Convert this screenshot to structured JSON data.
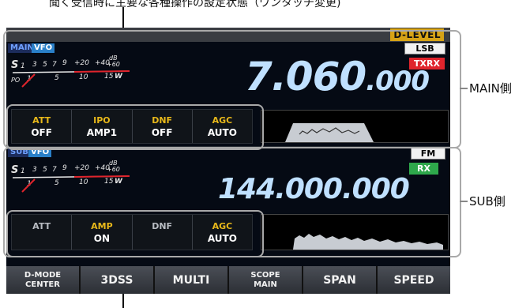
{
  "annotations": {
    "top_caption": "聞く受信時に主要な各種操作の設定状態（ワンタッチ変更)",
    "main_side": "MAIN側",
    "sub_side": "SUB側"
  },
  "header": {
    "dlevel": "D-LEVEL"
  },
  "main": {
    "badge_main": "MAIN",
    "badge_vfo": "VFO",
    "mode": "LSB",
    "txrx": "TXRX",
    "frequency": "7.060",
    "frequency_decimals": ".000",
    "functions": [
      {
        "name": "ATT",
        "value": "OFF",
        "name_color": "yellow"
      },
      {
        "name": "IPO",
        "value": "AMP1",
        "name_color": "yellow"
      },
      {
        "name": "DNF",
        "value": "OFF",
        "name_color": "yellow"
      },
      {
        "name": "AGC",
        "value": "AUTO",
        "name_color": "yellow"
      }
    ]
  },
  "sub": {
    "badge_sub": "SUB",
    "badge_vfo": "VFO",
    "mode": "FM",
    "rx": "RX",
    "frequency": "144.000.000",
    "functions": [
      {
        "name": "ATT",
        "value": "",
        "name_color": "gray"
      },
      {
        "name": "AMP",
        "value": "ON",
        "name_color": "yellow"
      },
      {
        "name": "DNF",
        "value": "",
        "name_color": "gray"
      },
      {
        "name": "AGC",
        "value": "AUTO",
        "name_color": "yellow"
      }
    ]
  },
  "meter": {
    "s_label": "S",
    "s_scale": [
      "1",
      "3",
      "5",
      "7",
      "9",
      "+20",
      "+40"
    ],
    "db_label": "dB",
    "plus60": "+60",
    "po_scale": [
      "1",
      "5",
      "10",
      "15"
    ],
    "w_label": "W",
    "po_label": "PO"
  },
  "softkeys": [
    {
      "line1": "D-MODE",
      "line2": "CENTER"
    },
    {
      "line1": "3DSS",
      "line2": ""
    },
    {
      "line1": "MULTI",
      "line2": ""
    },
    {
      "line1": "SCOPE",
      "line2": "MAIN"
    },
    {
      "line1": "SPAN",
      "line2": ""
    },
    {
      "line1": "SPEED",
      "line2": ""
    }
  ]
}
